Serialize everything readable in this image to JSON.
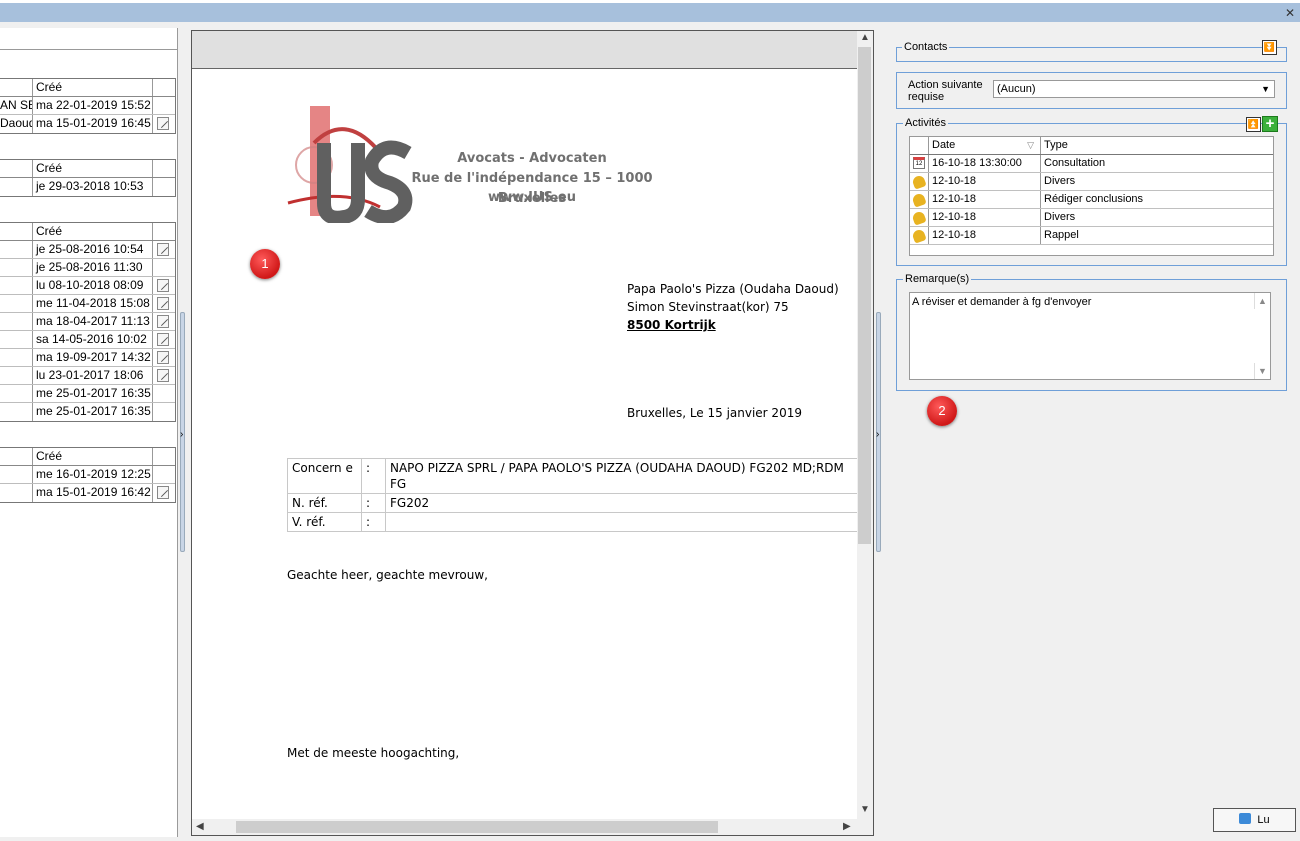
{
  "left_panel": {
    "col_header": "Créé",
    "group1": [
      {
        "c1": "AN SEF",
        "c2": "ma 22-01-2019 15:52",
        "note": false
      },
      {
        "c1": "Daoud",
        "c2": "ma 15-01-2019 16:45",
        "note": true
      }
    ],
    "group2": [
      {
        "c1": "",
        "c2": "je 29-03-2018 10:53",
        "note": false
      }
    ],
    "group3": [
      {
        "c1": "",
        "c2": "je 25-08-2016 10:54",
        "note": true
      },
      {
        "c1": "",
        "c2": "je 25-08-2016 11:30",
        "note": false
      },
      {
        "c1": "",
        "c2": "lu 08-10-2018 08:09",
        "note": true
      },
      {
        "c1": "",
        "c2": "me 11-04-2018 15:08",
        "note": true
      },
      {
        "c1": "",
        "c2": "ma 18-04-2017 11:13",
        "note": true
      },
      {
        "c1": "",
        "c2": "sa 14-05-2016 10:02",
        "note": true
      },
      {
        "c1": "",
        "c2": "ma 19-09-2017 14:32",
        "note": true
      },
      {
        "c1": "",
        "c2": "lu 23-01-2017 18:06",
        "note": true
      },
      {
        "c1": "",
        "c2": "me 25-01-2017 16:35",
        "note": false
      },
      {
        "c1": "",
        "c2": "me 25-01-2017 16:35",
        "note": false
      }
    ],
    "group4": [
      {
        "c1": "",
        "c2": "me 16-01-2019 12:25",
        "note": false
      },
      {
        "c1": "",
        "c2": "ma 15-01-2019 16:42",
        "note": true
      }
    ]
  },
  "document": {
    "firm_line1": "Avocats - Advocaten",
    "firm_line2": "Rue de l'indépendance 15 – 1000 Bruxelles",
    "firm_line3": "www.IUS.eu",
    "logo_text": "ius",
    "addr_line1": "Papa Paolo's Pizza (Oudaha Daoud)",
    "addr_line2": "Simon Stevinstraat(kor) 75",
    "addr_line3": "8500 Kortrijk",
    "date_line": "Bruxelles, Le 15 janvier 2019",
    "ref_rows": [
      {
        "label": "Concern e",
        "sep": ":",
        "value": "NAPO PIZZA SPRL / PAPA PAOLO'S PIZZA (OUDAHA DAOUD) FG202 MD;RDM FG"
      },
      {
        "label": "N. réf.",
        "sep": ":",
        "value": "FG202"
      },
      {
        "label": "V. réf.",
        "sep": ":",
        "value": ""
      }
    ],
    "salutation": "Geachte heer, geachte mevrouw,",
    "closing": "Met de meeste hoogachting,"
  },
  "badges": {
    "one": "1",
    "two": "2"
  },
  "right_panel": {
    "contacts_title": "Contacts",
    "action_label": "Action suivante requise",
    "action_value": "(Aucun)",
    "activities_title": "Activités",
    "activities_cols": {
      "date": "Date",
      "type": "Type"
    },
    "activities": [
      {
        "icon": "calendar-icon",
        "date": "16-10-18 13:30:00",
        "type": "Consultation"
      },
      {
        "icon": "bell-icon",
        "date": "12-10-18",
        "type": "Divers"
      },
      {
        "icon": "bell-icon",
        "date": "12-10-18",
        "type": "Rédiger conclusions"
      },
      {
        "icon": "bell-icon",
        "date": "12-10-18",
        "type": "Divers"
      },
      {
        "icon": "bell-icon",
        "date": "12-10-18",
        "type": "Rappel"
      }
    ],
    "remarks_title": "Remarque(s)",
    "remarks_text": "A réviser et demander à fg d'envoyer",
    "lu_button": "Lu"
  },
  "colors": {
    "accent_border": "#6f9fd8",
    "titlebar": "#a7c0dc",
    "badge": "#d01818"
  }
}
